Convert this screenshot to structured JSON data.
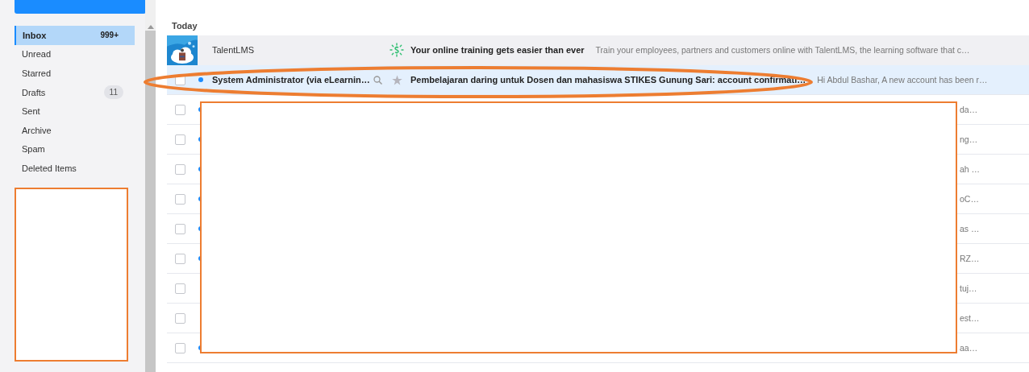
{
  "sidebar": {
    "items": [
      {
        "label": "Inbox",
        "count": "999+",
        "selected": true
      },
      {
        "label": "Unread",
        "selected": false
      },
      {
        "label": "Starred",
        "selected": false
      },
      {
        "label": "Drafts",
        "count": "11",
        "selected": false
      },
      {
        "label": "Sent",
        "selected": false
      },
      {
        "label": "Archive",
        "selected": false
      },
      {
        "label": "Spam",
        "selected": false
      },
      {
        "label": "Deleted Items",
        "selected": false
      }
    ]
  },
  "section_title": "Today",
  "messages": [
    {
      "kind": "avatar",
      "sender": "TalentLMS",
      "subject": "Your online training gets easier than ever",
      "preview": "Train your employees, partners and customers online with TalentLMS, the learning software that c…",
      "unread": false,
      "selected": false,
      "hover": true
    },
    {
      "kind": "checkbox",
      "sender": "System Administrator (via eLearnin…",
      "subject": "Pembelajaran daring untuk Dosen dan mahasiswa STIKES Gunung Sari: account confirmati…",
      "preview": "Hi Abdul Bashar, A new account has been r…",
      "unread": true,
      "selected": true,
      "hover": false,
      "checked": false
    },
    {
      "kind": "redacted",
      "tail": "da…",
      "unread": true,
      "selected": false,
      "checked": false
    },
    {
      "kind": "redacted",
      "tail": "ng…",
      "unread": true,
      "selected": false,
      "checked": false
    },
    {
      "kind": "redacted",
      "tail": "ah …",
      "unread": true,
      "selected": false,
      "checked": false
    },
    {
      "kind": "redacted",
      "tail": "oC…",
      "unread": true,
      "selected": false,
      "checked": false
    },
    {
      "kind": "redacted",
      "tail": "as …",
      "unread": true,
      "selected": false,
      "checked": false
    },
    {
      "kind": "redacted",
      "tail": "RZ…",
      "unread": true,
      "selected": false,
      "checked": false
    },
    {
      "kind": "redacted",
      "tail": "tuj…",
      "unread": false,
      "selected": false,
      "checked": false
    },
    {
      "kind": "redacted",
      "tail": "est…",
      "unread": false,
      "selected": false,
      "checked": false
    },
    {
      "kind": "redacted",
      "tail": "aa…",
      "unread": true,
      "selected": false,
      "checked": false
    }
  ]
}
